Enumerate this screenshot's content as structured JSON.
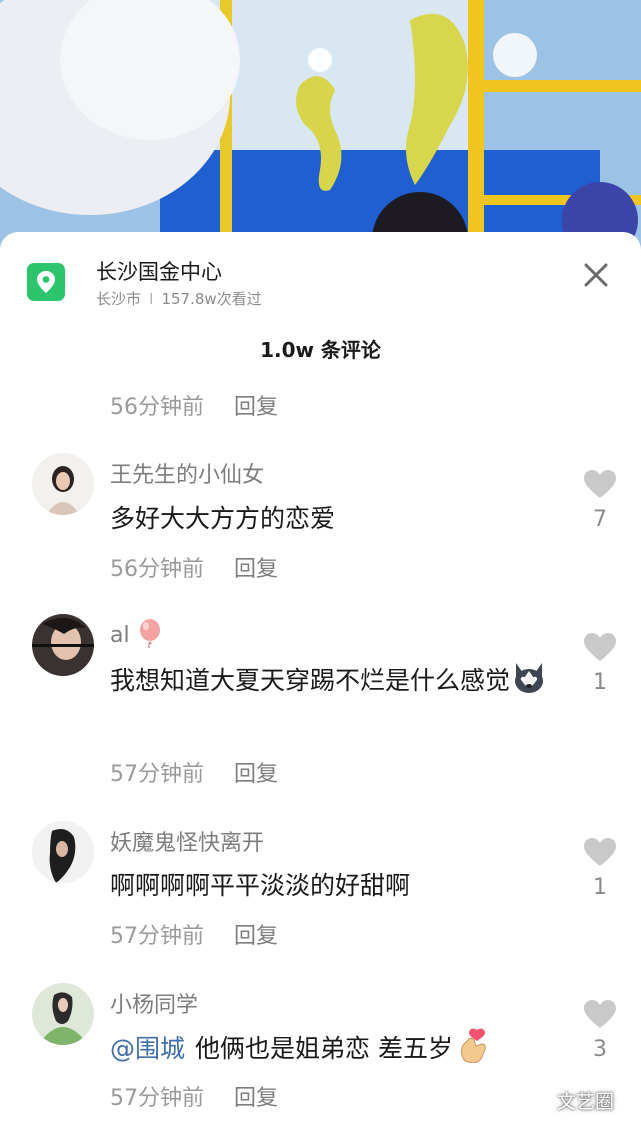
{
  "location": {
    "name": "长沙国金中心",
    "city": "长沙市",
    "separator": "I",
    "views": "157.8w次看过",
    "icon": "map-pin-icon",
    "accent_color": "#2cc56e"
  },
  "header": {
    "comment_count": "1.0w 条评论",
    "close_icon": "close-icon"
  },
  "first_meta": {
    "time": "56分钟前",
    "reply": "回复"
  },
  "comments": [
    {
      "username": "王先生的小仙女",
      "text": "多好大大方方的恋爱",
      "time": "56分钟前",
      "reply": "回复",
      "likes": "7"
    },
    {
      "username": "al",
      "username_emoji": "balloon-emoji",
      "text": "我想知道大夏天穿踢不烂是什么感觉",
      "text_emoji": "husky-emoji",
      "time": "57分钟前",
      "reply": "回复",
      "likes": "1"
    },
    {
      "username": "妖魔鬼怪快离开",
      "text": "啊啊啊啊平平淡淡的好甜啊",
      "time": "57分钟前",
      "reply": "回复",
      "likes": "1"
    },
    {
      "username": "小杨同学",
      "mention": "@围城",
      "text": "他俩也是姐弟恋 差五岁",
      "text_emoji": "finger-heart-emoji",
      "time": "57分钟前",
      "reply": "回复",
      "likes": "3"
    }
  ],
  "watermark": "文艺圈"
}
